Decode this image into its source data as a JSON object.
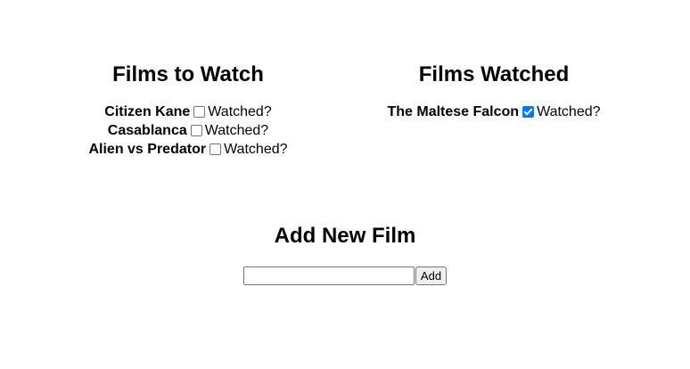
{
  "films_to_watch": {
    "title": "Films to Watch",
    "items": [
      {
        "title": "Citizen Kane",
        "checkbox_label": "Watched?",
        "checked": false
      },
      {
        "title": "Casablanca",
        "checkbox_label": "Watched?",
        "checked": false
      },
      {
        "title": "Alien vs Predator",
        "checkbox_label": "Watched?",
        "checked": false
      }
    ]
  },
  "films_watched": {
    "title": "Films Watched",
    "items": [
      {
        "title": "The Maltese Falcon",
        "checkbox_label": "Watched?",
        "checked": true
      }
    ]
  },
  "add_film": {
    "title": "Add New Film",
    "input_value": "",
    "button_label": "Add"
  },
  "colors": {
    "checkbox_checked": "#0075ff",
    "checkbox_border": "#767676",
    "button_background": "#efefef"
  }
}
